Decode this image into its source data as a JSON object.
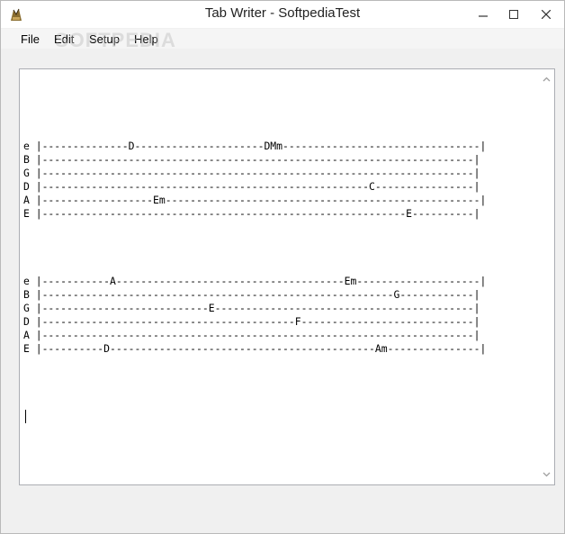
{
  "window": {
    "title": "Tab Writer - SoftpediaTest",
    "icon": "app-icon",
    "controls": [
      "minimize-icon",
      "maximize-icon",
      "close-icon"
    ]
  },
  "menu": {
    "items": [
      {
        "label": "File"
      },
      {
        "label": "Edit"
      },
      {
        "label": "Setup"
      },
      {
        "label": "Help"
      }
    ]
  },
  "watermark": "SOFTPEDIA",
  "editor": {
    "lines": [
      "",
      "",
      "",
      "",
      "",
      "e |--------------D---------------------DMm--------------------------------|",
      "B |----------------------------------------------------------------------|",
      "G |----------------------------------------------------------------------|",
      "D |-----------------------------------------------------C----------------|",
      "A |------------------Em---------------------------------------------------|",
      "E |-----------------------------------------------------------E----------|",
      "",
      "",
      "",
      "",
      "e |-----------A-------------------------------------Em--------------------|",
      "B |---------------------------------------------------------G------------|",
      "G |---------------------------E------------------------------------------|",
      "D |-----------------------------------------F----------------------------|",
      "A |----------------------------------------------------------------------|",
      "E |----------D-------------------------------------------Am---------------|"
    ]
  }
}
